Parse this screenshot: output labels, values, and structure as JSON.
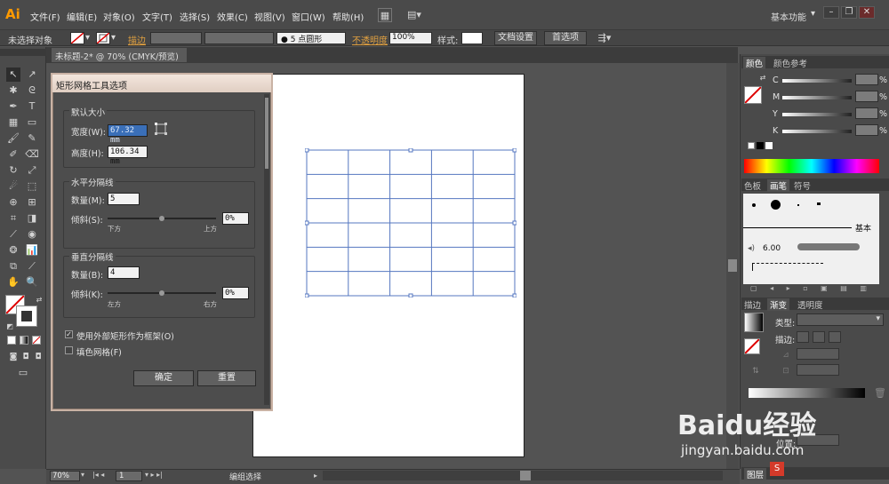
{
  "app": {
    "logo": "Ai"
  },
  "menu": [
    "文件(F)",
    "编辑(E)",
    "对象(O)",
    "文字(T)",
    "选择(S)",
    "效果(C)",
    "视图(V)",
    "窗口(W)",
    "帮助(H)"
  ],
  "workspace": "基本功能",
  "control_bar": {
    "selection": "未选择对象",
    "stroke_label": "描边",
    "brush": "5 点圆形",
    "opacity_label": "不透明度",
    "opacity_value": "100%",
    "style_label": "样式:",
    "doc_setup": "文档设置",
    "preferences": "首选项"
  },
  "document_tab": {
    "title": "未标题-2* @ 70% (CMYK/预览)",
    "close": "×"
  },
  "dialog": {
    "title": "矩形网格工具选项",
    "default_size": {
      "legend": "默认大小",
      "width_label": "宽度(W):",
      "width_value": "67.32 mm",
      "height_label": "高度(H):",
      "height_value": "106.34 mm"
    },
    "horizontal_dividers": {
      "legend": "水平分隔线",
      "count_label": "数量(M):",
      "count_value": "5",
      "skew_label": "倾斜(S):",
      "skew_value": "0%",
      "left_tick": "下方",
      "right_tick": "上方"
    },
    "vertical_dividers": {
      "legend": "垂直分隔线",
      "count_label": "数量(B):",
      "count_value": "4",
      "skew_label": "倾斜(K):",
      "skew_value": "0%",
      "left_tick": "左方",
      "right_tick": "右方"
    },
    "use_outer_rect": {
      "label": "使用外部矩形作为框架(O)",
      "checked": true
    },
    "fill_grid": {
      "label": "填色网格(F)",
      "checked": false
    },
    "ok": "确定",
    "reset": "重置"
  },
  "panels": {
    "color": {
      "tabs": [
        "颜色",
        "颜色参考"
      ],
      "channels": [
        "C",
        "M",
        "Y",
        "K"
      ],
      "unit": "%"
    },
    "brushes": {
      "tabs": [
        "色板",
        "画笔",
        "符号"
      ],
      "basic": "基本",
      "size": "6.00"
    },
    "gradient": {
      "tabs": [
        "描边",
        "渐变",
        "透明度"
      ],
      "type_label": "类型:",
      "stroke_label": "描边:",
      "location_label": "位置:"
    },
    "bottom_tab": "图层"
  },
  "status": {
    "zoom": "70%",
    "page": "1",
    "mode": "编组选择"
  },
  "grid": {
    "rows": 6,
    "cols": 5,
    "color": "#5577c0"
  },
  "watermark": {
    "line1": "Baidu经验",
    "line2": "jingyan.baidu.com"
  }
}
